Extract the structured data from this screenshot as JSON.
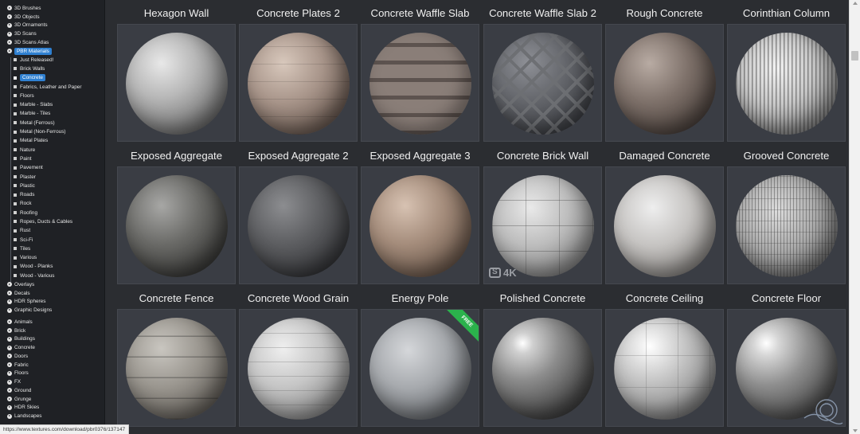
{
  "sidebar": {
    "top_items": [
      {
        "label": "3D Brushes"
      },
      {
        "label": "3D Objects"
      },
      {
        "label": "3D Ornaments"
      },
      {
        "label": "3D Scans"
      },
      {
        "label": "3D Scans Atlas"
      },
      {
        "label": "PBR Materials",
        "active": true
      }
    ],
    "pbr_sub_items": [
      {
        "label": "Just Released!"
      },
      {
        "label": "Brick Walls"
      },
      {
        "label": "Concrete",
        "active": true
      },
      {
        "label": "Fabrics, Leather and Paper"
      },
      {
        "label": "Floors"
      },
      {
        "label": "Marble - Slabs"
      },
      {
        "label": "Marble - Tiles"
      },
      {
        "label": "Metal (Ferrous)"
      },
      {
        "label": "Metal (Non-Ferrous)"
      },
      {
        "label": "Metal Plates"
      },
      {
        "label": "Nature"
      },
      {
        "label": "Paint"
      },
      {
        "label": "Pavement"
      },
      {
        "label": "Plaster"
      },
      {
        "label": "Plastic"
      },
      {
        "label": "Roads"
      },
      {
        "label": "Rock"
      },
      {
        "label": "Roofing"
      },
      {
        "label": "Ropes, Ducts & Cables"
      },
      {
        "label": "Rust"
      },
      {
        "label": "Sci-Fi"
      },
      {
        "label": "Tiles"
      },
      {
        "label": "Various"
      },
      {
        "label": "Wood - Planks"
      },
      {
        "label": "Wood - Various"
      }
    ],
    "mid_items": [
      {
        "label": "Overlays"
      },
      {
        "label": "Decals"
      },
      {
        "label": "HDR Spheres"
      },
      {
        "label": "Graphic Designs"
      }
    ],
    "bottom_items": [
      {
        "label": "Animals"
      },
      {
        "label": "Brick"
      },
      {
        "label": "Buildings"
      },
      {
        "label": "Concrete"
      },
      {
        "label": "Doors"
      },
      {
        "label": "Fabric"
      },
      {
        "label": "Floors"
      },
      {
        "label": "FX"
      },
      {
        "label": "Ground"
      },
      {
        "label": "Grunge"
      },
      {
        "label": "HDR Skies"
      },
      {
        "label": "Landscapes"
      }
    ]
  },
  "materials": [
    {
      "title": "Hexagon Wall",
      "style": "hex"
    },
    {
      "title": "Concrete Plates 2",
      "style": "plates"
    },
    {
      "title": "Concrete Waffle Slab",
      "style": "waffle"
    },
    {
      "title": "Concrete Waffle Slab 2",
      "style": "waffle2"
    },
    {
      "title": "Rough Concrete",
      "style": "rough"
    },
    {
      "title": "Corinthian Column",
      "style": "column"
    },
    {
      "title": "Exposed Aggregate",
      "style": "agg1"
    },
    {
      "title": "Exposed Aggregate 2",
      "style": "agg2"
    },
    {
      "title": "Exposed Aggregate 3",
      "style": "agg3"
    },
    {
      "title": "Concrete Brick Wall",
      "style": "brickwall",
      "badge": "4K"
    },
    {
      "title": "Damaged Concrete",
      "style": "damaged"
    },
    {
      "title": "Grooved Concrete",
      "style": "grooved"
    },
    {
      "title": "Concrete Fence",
      "style": "fence"
    },
    {
      "title": "Concrete Wood Grain",
      "style": "woodgrain"
    },
    {
      "title": "Energy Pole",
      "style": "pole",
      "ribbon": "FREE"
    },
    {
      "title": "Polished Concrete",
      "style": "polished"
    },
    {
      "title": "Concrete Ceiling",
      "style": "ceiling"
    },
    {
      "title": "Concrete Floor",
      "style": "floor"
    }
  ],
  "status_url": "https://www.textures.com/download/pbr0376/137147",
  "colors": {
    "accent": "#2f80d1",
    "free_ribbon": "#2bb24c",
    "sidebar_bg": "#1f2125",
    "page_bg": "#2b2d31"
  }
}
